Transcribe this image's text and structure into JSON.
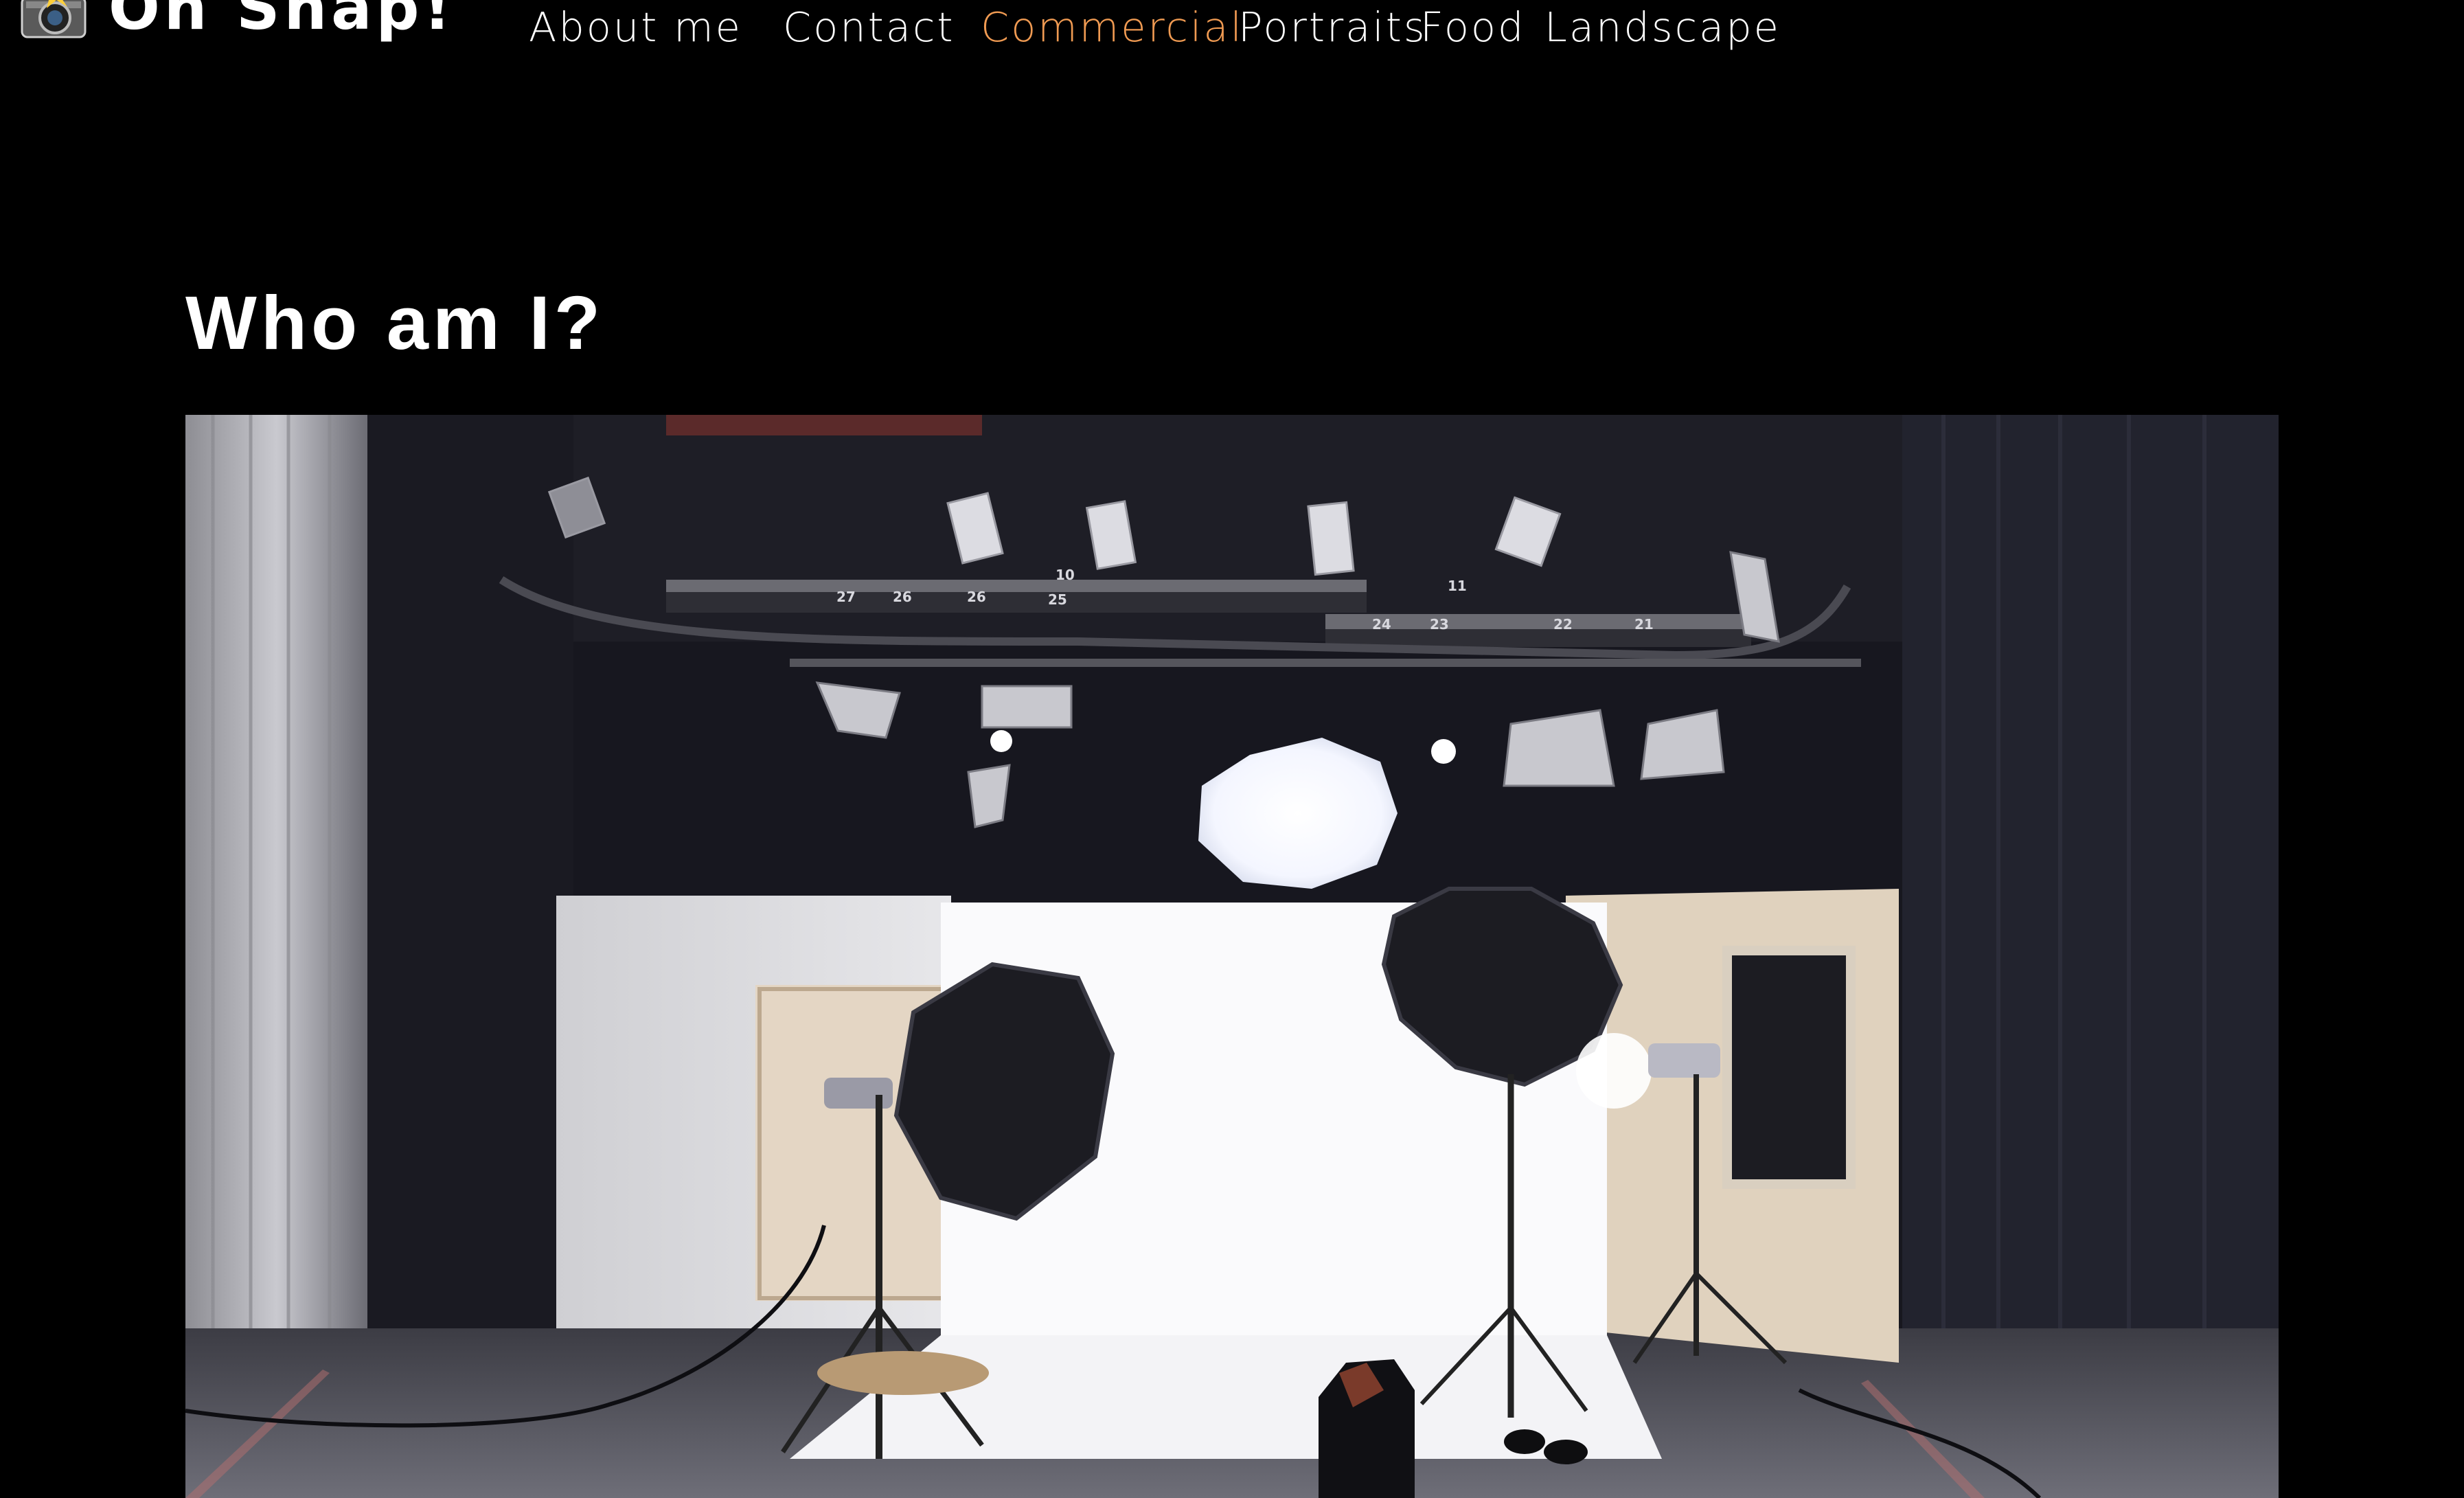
{
  "brand": {
    "name": "Oh Snap!",
    "logo_icon": "camera-flash-icon"
  },
  "nav": {
    "items": [
      {
        "label": "About me",
        "active": false
      },
      {
        "label": "Contact",
        "active": false
      },
      {
        "label": "Commercial",
        "active": true
      },
      {
        "label": "Portraits",
        "active": false
      },
      {
        "label": "Food",
        "active": false
      },
      {
        "label": "Landscape",
        "active": false
      }
    ]
  },
  "main": {
    "title": "Who am I?",
    "hero_image": {
      "subject": "photo-studio-with-softboxes-and-white-backdrop",
      "rig_numbers": [
        "27",
        "26",
        "26",
        "25",
        "10",
        "11",
        "24",
        "23",
        "22",
        "21"
      ]
    }
  },
  "colors": {
    "background": "#000000",
    "text": "#ffffff",
    "accent": "#ef9a52"
  }
}
